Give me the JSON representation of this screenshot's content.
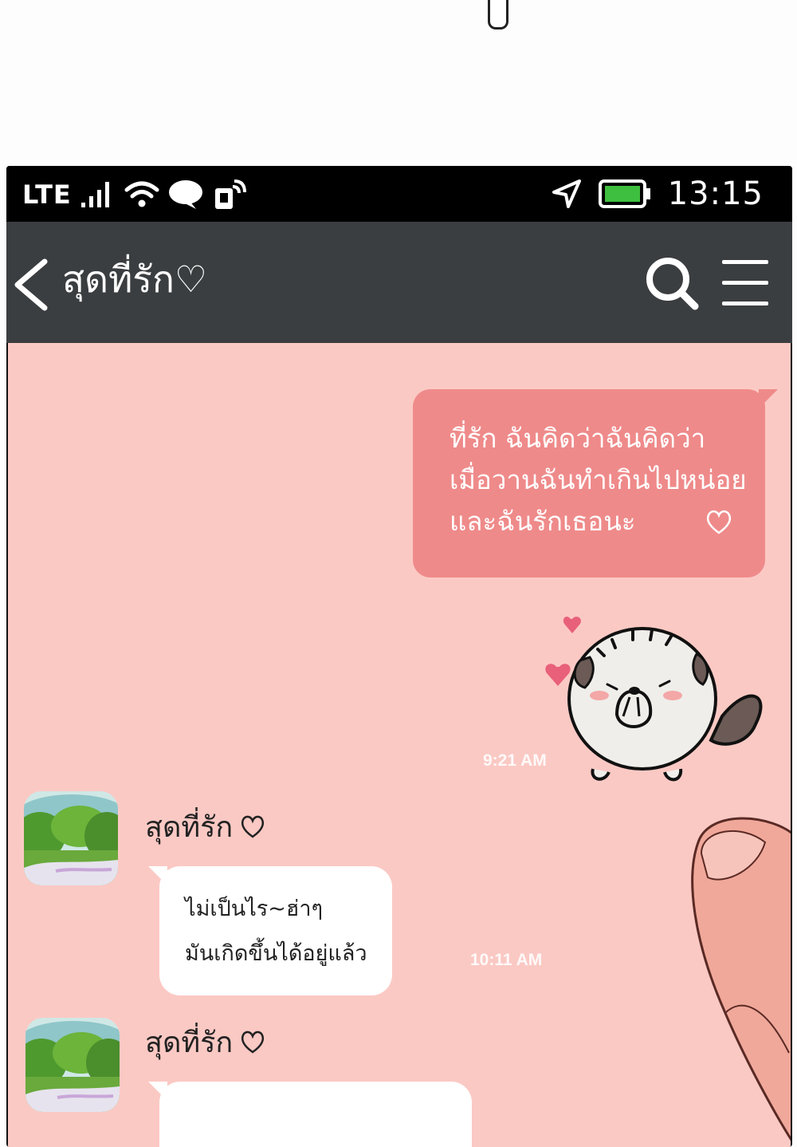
{
  "status_bar": {
    "network": "LTE",
    "time": "13:15"
  },
  "header": {
    "title": "สุดที่รัก♡"
  },
  "messages": {
    "outgoing": {
      "lines": [
        "ที่รัก ฉันคิดว่าฉันคิดว่า",
        "เมื่อวานฉันทำเกินไปหน่อย",
        "และฉันรักเธอนะ"
      ],
      "sticker_time": "9:21 AM"
    },
    "incoming_1": {
      "sender": "สุดที่รัก",
      "lines": [
        "ไม่เป็นไร~ฮ่าๆ",
        "มันเกิดขึ้นได้อยู่แล้ว"
      ],
      "time": "10:11 AM"
    },
    "incoming_2": {
      "sender": "สุดที่รัก"
    }
  },
  "colors": {
    "chat_background": "#fbc9c4",
    "outgoing_bubble": "#ef8a8a",
    "header": "#3b3e40"
  },
  "icons": [
    "signal-icon",
    "wifi-icon",
    "chat-icon",
    "notification-icon",
    "location-icon",
    "battery-icon",
    "back-arrow-icon",
    "search-icon",
    "menu-icon",
    "heart-icon"
  ]
}
